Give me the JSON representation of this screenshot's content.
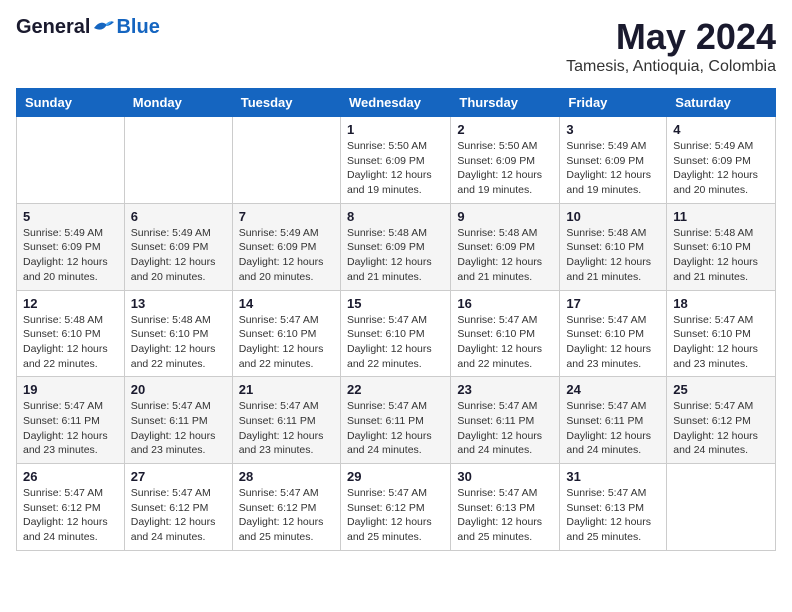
{
  "logo": {
    "general": "General",
    "blue": "Blue"
  },
  "title": "May 2024",
  "location": "Tamesis, Antioquia, Colombia",
  "weekdays": [
    "Sunday",
    "Monday",
    "Tuesday",
    "Wednesday",
    "Thursday",
    "Friday",
    "Saturday"
  ],
  "weeks": [
    [
      {
        "day": "",
        "info": ""
      },
      {
        "day": "",
        "info": ""
      },
      {
        "day": "",
        "info": ""
      },
      {
        "day": "1",
        "info": "Sunrise: 5:50 AM\nSunset: 6:09 PM\nDaylight: 12 hours\nand 19 minutes."
      },
      {
        "day": "2",
        "info": "Sunrise: 5:50 AM\nSunset: 6:09 PM\nDaylight: 12 hours\nand 19 minutes."
      },
      {
        "day": "3",
        "info": "Sunrise: 5:49 AM\nSunset: 6:09 PM\nDaylight: 12 hours\nand 19 minutes."
      },
      {
        "day": "4",
        "info": "Sunrise: 5:49 AM\nSunset: 6:09 PM\nDaylight: 12 hours\nand 20 minutes."
      }
    ],
    [
      {
        "day": "5",
        "info": "Sunrise: 5:49 AM\nSunset: 6:09 PM\nDaylight: 12 hours\nand 20 minutes."
      },
      {
        "day": "6",
        "info": "Sunrise: 5:49 AM\nSunset: 6:09 PM\nDaylight: 12 hours\nand 20 minutes."
      },
      {
        "day": "7",
        "info": "Sunrise: 5:49 AM\nSunset: 6:09 PM\nDaylight: 12 hours\nand 20 minutes."
      },
      {
        "day": "8",
        "info": "Sunrise: 5:48 AM\nSunset: 6:09 PM\nDaylight: 12 hours\nand 21 minutes."
      },
      {
        "day": "9",
        "info": "Sunrise: 5:48 AM\nSunset: 6:09 PM\nDaylight: 12 hours\nand 21 minutes."
      },
      {
        "day": "10",
        "info": "Sunrise: 5:48 AM\nSunset: 6:10 PM\nDaylight: 12 hours\nand 21 minutes."
      },
      {
        "day": "11",
        "info": "Sunrise: 5:48 AM\nSunset: 6:10 PM\nDaylight: 12 hours\nand 21 minutes."
      }
    ],
    [
      {
        "day": "12",
        "info": "Sunrise: 5:48 AM\nSunset: 6:10 PM\nDaylight: 12 hours\nand 22 minutes."
      },
      {
        "day": "13",
        "info": "Sunrise: 5:48 AM\nSunset: 6:10 PM\nDaylight: 12 hours\nand 22 minutes."
      },
      {
        "day": "14",
        "info": "Sunrise: 5:47 AM\nSunset: 6:10 PM\nDaylight: 12 hours\nand 22 minutes."
      },
      {
        "day": "15",
        "info": "Sunrise: 5:47 AM\nSunset: 6:10 PM\nDaylight: 12 hours\nand 22 minutes."
      },
      {
        "day": "16",
        "info": "Sunrise: 5:47 AM\nSunset: 6:10 PM\nDaylight: 12 hours\nand 22 minutes."
      },
      {
        "day": "17",
        "info": "Sunrise: 5:47 AM\nSunset: 6:10 PM\nDaylight: 12 hours\nand 23 minutes."
      },
      {
        "day": "18",
        "info": "Sunrise: 5:47 AM\nSunset: 6:10 PM\nDaylight: 12 hours\nand 23 minutes."
      }
    ],
    [
      {
        "day": "19",
        "info": "Sunrise: 5:47 AM\nSunset: 6:11 PM\nDaylight: 12 hours\nand 23 minutes."
      },
      {
        "day": "20",
        "info": "Sunrise: 5:47 AM\nSunset: 6:11 PM\nDaylight: 12 hours\nand 23 minutes."
      },
      {
        "day": "21",
        "info": "Sunrise: 5:47 AM\nSunset: 6:11 PM\nDaylight: 12 hours\nand 23 minutes."
      },
      {
        "day": "22",
        "info": "Sunrise: 5:47 AM\nSunset: 6:11 PM\nDaylight: 12 hours\nand 24 minutes."
      },
      {
        "day": "23",
        "info": "Sunrise: 5:47 AM\nSunset: 6:11 PM\nDaylight: 12 hours\nand 24 minutes."
      },
      {
        "day": "24",
        "info": "Sunrise: 5:47 AM\nSunset: 6:11 PM\nDaylight: 12 hours\nand 24 minutes."
      },
      {
        "day": "25",
        "info": "Sunrise: 5:47 AM\nSunset: 6:12 PM\nDaylight: 12 hours\nand 24 minutes."
      }
    ],
    [
      {
        "day": "26",
        "info": "Sunrise: 5:47 AM\nSunset: 6:12 PM\nDaylight: 12 hours\nand 24 minutes."
      },
      {
        "day": "27",
        "info": "Sunrise: 5:47 AM\nSunset: 6:12 PM\nDaylight: 12 hours\nand 24 minutes."
      },
      {
        "day": "28",
        "info": "Sunrise: 5:47 AM\nSunset: 6:12 PM\nDaylight: 12 hours\nand 25 minutes."
      },
      {
        "day": "29",
        "info": "Sunrise: 5:47 AM\nSunset: 6:12 PM\nDaylight: 12 hours\nand 25 minutes."
      },
      {
        "day": "30",
        "info": "Sunrise: 5:47 AM\nSunset: 6:13 PM\nDaylight: 12 hours\nand 25 minutes."
      },
      {
        "day": "31",
        "info": "Sunrise: 5:47 AM\nSunset: 6:13 PM\nDaylight: 12 hours\nand 25 minutes."
      },
      {
        "day": "",
        "info": ""
      }
    ]
  ]
}
